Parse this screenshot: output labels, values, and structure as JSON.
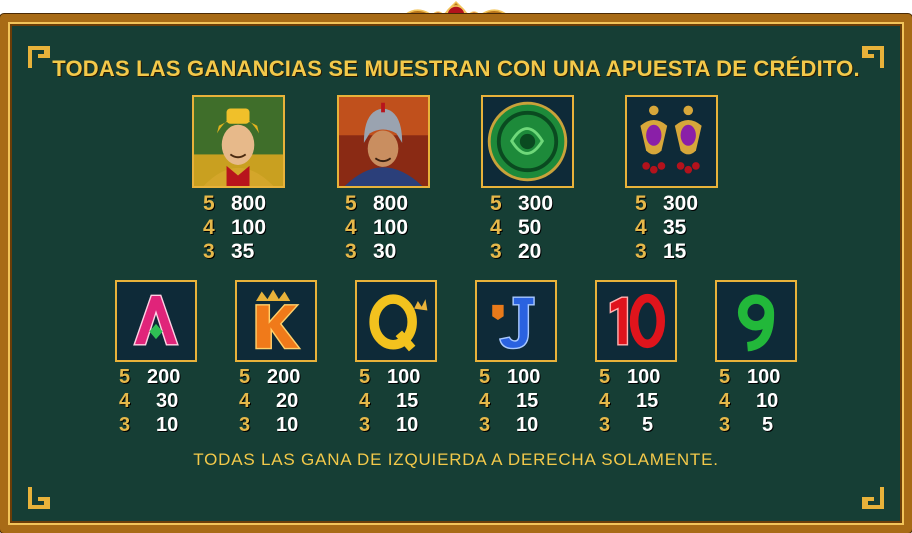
{
  "header": "TODAS LAS GANANCIAS SE MUESTRAN CON UNA APUESTA DE CRÉDITO.",
  "footer": "TODAS LAS GANA DE IZQUIERDA A DERECHA SOLAMENTE.",
  "colors": {
    "panel": "#163e35",
    "gold": "#f3c94a",
    "frame": "#a86b16",
    "symbol_bg": "#0e2a38"
  },
  "high_symbols": [
    {
      "name": "emperor-icon",
      "pays": [
        {
          "count": "5",
          "value": "800"
        },
        {
          "count": "4",
          "value": "100"
        },
        {
          "count": "3",
          "value": "35"
        }
      ]
    },
    {
      "name": "warrior-icon",
      "pays": [
        {
          "count": "5",
          "value": "800"
        },
        {
          "count": "4",
          "value": "100"
        },
        {
          "count": "3",
          "value": "30"
        }
      ]
    },
    {
      "name": "jade-coin-icon",
      "pays": [
        {
          "count": "5",
          "value": "300"
        },
        {
          "count": "4",
          "value": "50"
        },
        {
          "count": "3",
          "value": "20"
        }
      ]
    },
    {
      "name": "earrings-icon",
      "pays": [
        {
          "count": "5",
          "value": "300"
        },
        {
          "count": "4",
          "value": "35"
        },
        {
          "count": "3",
          "value": "15"
        }
      ]
    }
  ],
  "low_symbols": [
    {
      "name": "ace-icon",
      "glyph": "A",
      "pays": [
        {
          "count": "5",
          "value": "200"
        },
        {
          "count": "4",
          "value": "30"
        },
        {
          "count": "3",
          "value": "10"
        }
      ]
    },
    {
      "name": "king-icon",
      "glyph": "K",
      "pays": [
        {
          "count": "5",
          "value": "200"
        },
        {
          "count": "4",
          "value": "20"
        },
        {
          "count": "3",
          "value": "10"
        }
      ]
    },
    {
      "name": "queen-icon",
      "glyph": "Q",
      "pays": [
        {
          "count": "5",
          "value": "100"
        },
        {
          "count": "4",
          "value": "15"
        },
        {
          "count": "3",
          "value": "10"
        }
      ]
    },
    {
      "name": "jack-icon",
      "glyph": "J",
      "pays": [
        {
          "count": "5",
          "value": "100"
        },
        {
          "count": "4",
          "value": "15"
        },
        {
          "count": "3",
          "value": "10"
        }
      ]
    },
    {
      "name": "ten-icon",
      "glyph": "10",
      "pays": [
        {
          "count": "5",
          "value": "100"
        },
        {
          "count": "4",
          "value": "15"
        },
        {
          "count": "3",
          "value": "5"
        }
      ]
    },
    {
      "name": "nine-icon",
      "glyph": "9",
      "pays": [
        {
          "count": "5",
          "value": "100"
        },
        {
          "count": "4",
          "value": "10"
        },
        {
          "count": "3",
          "value": "5"
        }
      ]
    }
  ]
}
